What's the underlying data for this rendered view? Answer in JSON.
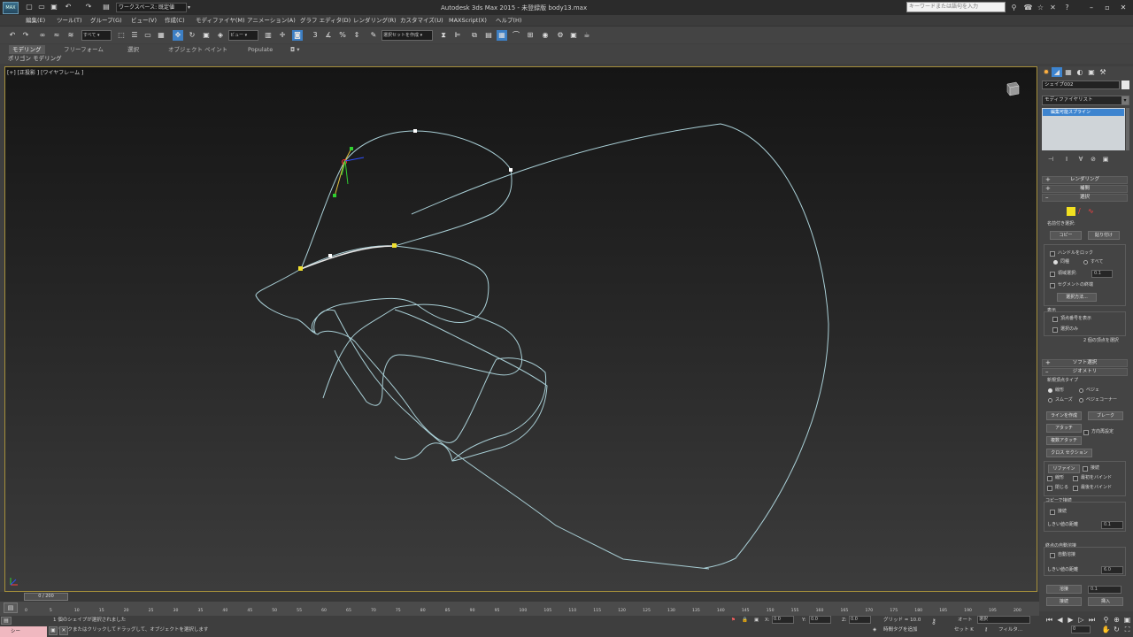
{
  "app": {
    "logo_text": "MAX",
    "workspace": "ワークスペース: 既定値",
    "title": "Autodesk 3ds Max  2015  -  未登録版    body13.max",
    "search_placeholder": "キーワードまたは語句を入力"
  },
  "menus": [
    "編集(E)",
    "ツール(T)",
    "グループ(G)",
    "ビュー(V)",
    "作成(C)",
    "モディファイヤ(M)",
    "アニメーション(A)",
    "グラフ エディタ(D)",
    "レンダリング(R)",
    "カスタマイズ(U)",
    "MAXScript(X)",
    "ヘルプ(H)"
  ],
  "toolbar": {
    "filter": "すべて",
    "refcoord": "ビュー",
    "selection_set": "選択セットを作成"
  },
  "ribbon": {
    "tabs": [
      "モデリング",
      "フリーフォーム",
      "選択",
      "オブジェクト ペイント",
      "Populate"
    ],
    "subpanel": "ポリゴン モデリング"
  },
  "viewport": {
    "label": "[+] [正投影 ] [ワイヤフレーム ]"
  },
  "command_panel": {
    "object_name": "シェイプ002",
    "modifier_list": "モディファイヤリスト",
    "stack_item": "編集可能スプライン",
    "rollouts": {
      "rendering": "レンダリング",
      "interpolation": "補間",
      "selection": "選択",
      "soft_selection": "ソフト選択",
      "geometry": "ジオメトリ"
    },
    "selection": {
      "named_sel": "名前付き選択:",
      "copy": "コピー",
      "paste": "貼り付け",
      "lock_handles": "ハンドルをロック",
      "alike": "同種",
      "all": "すべて",
      "area_sel": "領域選択:",
      "area_val": "0.1",
      "segment_end": "セグメントの終端",
      "select_by": "選択方法...",
      "display": "表示",
      "show_vertex_numbers": "頂点番号を表示",
      "selected_only": "選択のみ",
      "status": "2 個の頂点を選択"
    },
    "geometry": {
      "new_vertex_type": "新規頂点タイプ",
      "linear": "線形",
      "bezier": "ベジェ",
      "smooth": "スムーズ",
      "bezier_corner": "ベジェコーナー",
      "create_line": "ラインを作成",
      "break": "ブレーク",
      "attach": "アタッチ",
      "reorient": "方向再設定",
      "attach_mult": "複数アタッチ",
      "cross_section": "クロス セクション",
      "refine": "リファイン",
      "connect": "接続",
      "linear2": "線形",
      "bind_first": "最初をバインド",
      "closed": "閉じる",
      "bind_last": "最後をバインド",
      "connect_copy": "コピーで接続",
      "connect2": "接続",
      "threshold": "しきい値の距離",
      "threshold_val": "0.1",
      "end_auto_weld": "終点の自動溶接",
      "auto_weld": "自動溶接",
      "threshold2": "しきい値の距離",
      "threshold2_val": "6.0",
      "weld": "溶接",
      "weld_val": "0.1",
      "connect3": "接続",
      "insert": "挿入"
    }
  },
  "timeline": {
    "slider": "0 / 200",
    "ticks": [
      "0",
      "5",
      "10",
      "15",
      "20",
      "25",
      "30",
      "35",
      "40",
      "45",
      "50",
      "55",
      "60",
      "65",
      "70",
      "75",
      "80",
      "85",
      "90",
      "95",
      "100",
      "105",
      "110",
      "115",
      "120",
      "125",
      "130",
      "135",
      "140",
      "145",
      "150",
      "155",
      "160",
      "165",
      "170",
      "175",
      "180",
      "185",
      "190",
      "195",
      "200"
    ]
  },
  "status": {
    "maxscript": "シー",
    "line1": "1 個のシェイプが選択されました",
    "line2": "クリックまたはクリックしてドラッグして、オブジェクトを選択します",
    "x_label": "X:",
    "x_val": "0.0",
    "y_label": "Y:",
    "y_val": "0.0",
    "z_label": "Z:",
    "z_val": "0.0",
    "grid": "グリッド = 10.0",
    "add_time_tag": "時間タグを追加",
    "auto_key": "オート",
    "set_key": "セット K",
    "key_sel": "選択",
    "filter": "フィルタ...",
    "frame": "0"
  },
  "colors": {
    "spline": "#a9cfd6",
    "vertex_selected": "#f0e030",
    "active_blue": "#3d84cf",
    "viewport_border": "#a58f3a"
  }
}
